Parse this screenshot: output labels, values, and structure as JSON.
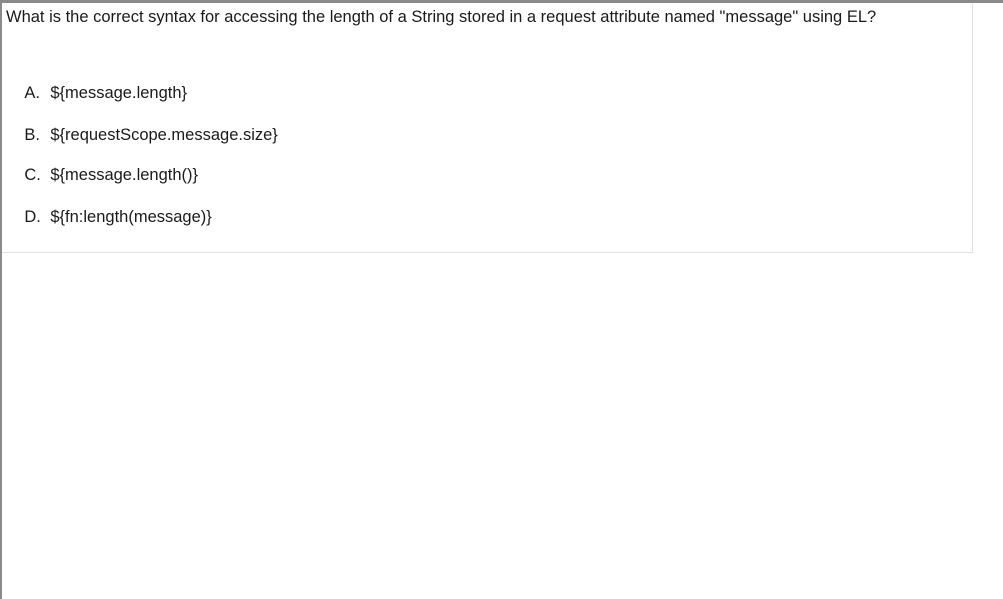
{
  "question": {
    "text": "What is the correct syntax for accessing the length of a String stored in a request attribute named \"message\" using EL?"
  },
  "options": [
    {
      "letter": "A.",
      "text": "${message.length}"
    },
    {
      "letter": "B.",
      "text": "${requestScope.message.size}"
    },
    {
      "letter": "C.",
      "text": "${message.length()}"
    },
    {
      "letter": "D.",
      "text": "${fn:length(message)}"
    }
  ]
}
